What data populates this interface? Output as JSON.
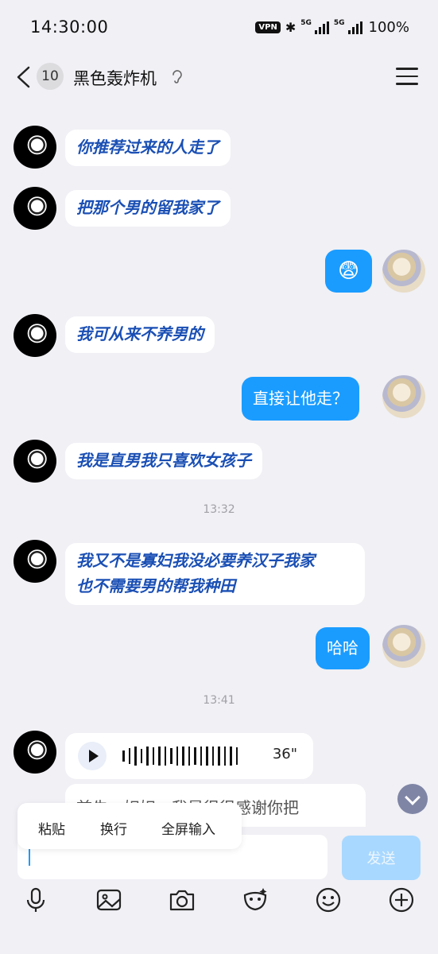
{
  "status": {
    "time": "14:30:00",
    "vpn": "VPN",
    "net1": "5G",
    "net2": "5G",
    "battery": "100%"
  },
  "header": {
    "badge": "10",
    "title": "黑色轰炸机"
  },
  "messages": {
    "m1": "你推荐过来的人走了",
    "m2": "把那个男的留我家了",
    "m3": "😨",
    "m4": "我可从来不养男的",
    "m5": "直接让他走？",
    "m6": "我是直男我只喜欢女孩子",
    "ts1": "13:32",
    "m7a": "我又不是寡妇我没必要养汉子我家",
    "m7b": "也不需要男的帮我种田",
    "m8": "哈哈",
    "ts2": "13:41",
    "voice_duration": "36\"",
    "partial_text": "首先，妲妲，我是很很感谢你把"
  },
  "context_menu": {
    "paste": "粘贴",
    "newline": "换行",
    "fullscreen": "全屏输入"
  },
  "input": {
    "send_label": "发送"
  },
  "toolbar": [
    "mic-icon",
    "image-icon",
    "camera-icon",
    "sticker-icon",
    "emoji-icon",
    "plus-icon"
  ]
}
